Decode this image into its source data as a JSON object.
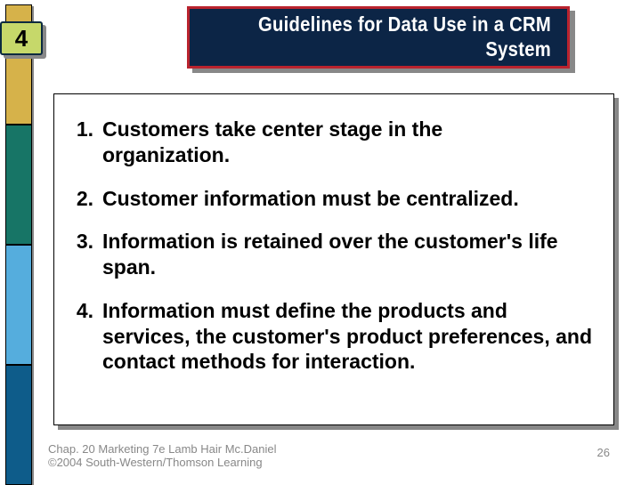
{
  "badge": {
    "number": "4"
  },
  "title": {
    "text": "Guidelines for Data Use in a CRM System"
  },
  "items": [
    {
      "num": "1.",
      "text": "Customers take center stage in the organization."
    },
    {
      "num": "2.",
      "text": "Customer information must be centralized."
    },
    {
      "num": "3.",
      "text": "Information is retained over the customer's life span."
    },
    {
      "num": "4.",
      "text": "Information must define the products and services, the customer's product preferences, and contact methods for interaction."
    }
  ],
  "footer": {
    "line1": "Chap. 20 Marketing 7e Lamb Hair Mc.Daniel",
    "line2": "©2004 South-Western/Thomson Learning",
    "page": "26"
  }
}
